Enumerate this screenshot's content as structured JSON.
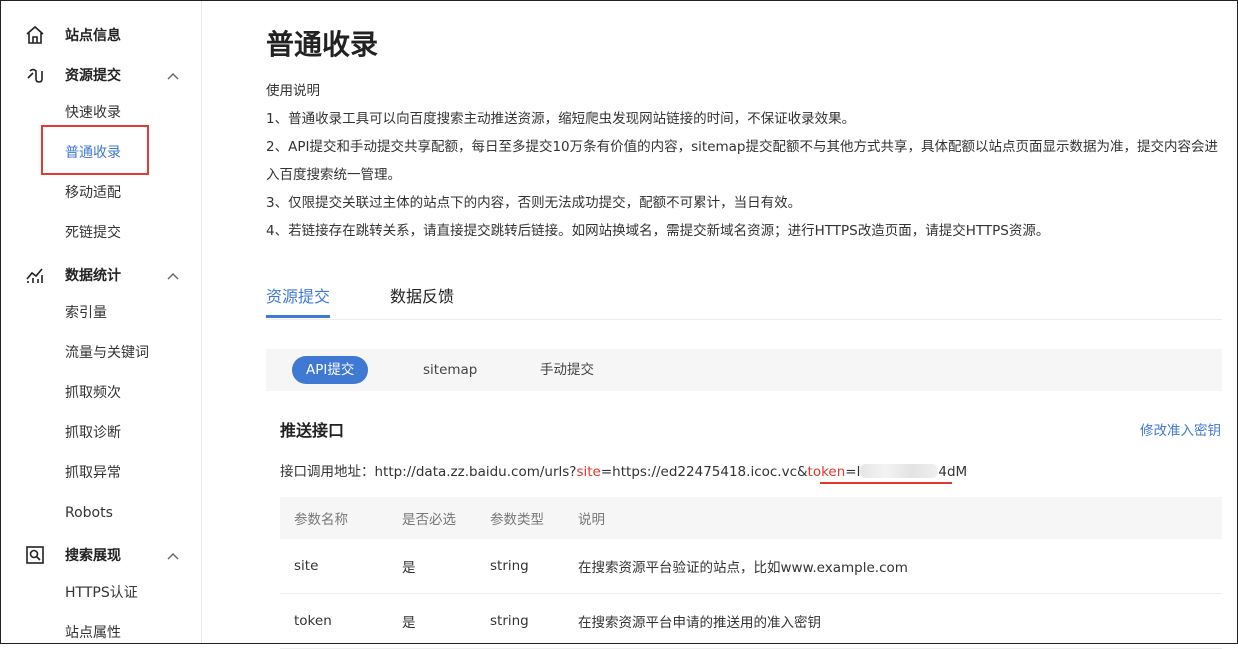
{
  "sidebar": {
    "sections": [
      {
        "label": "站点信息",
        "icon": "home-icon"
      },
      {
        "label": "资源提交",
        "icon": "resource-submit-icon"
      },
      {
        "label": "数据统计",
        "icon": "statistics-icon"
      },
      {
        "label": "搜索展现",
        "icon": "search-display-icon"
      }
    ],
    "items": {
      "submit": [
        "快速收录",
        "普通收录",
        "移动适配",
        "死链提交"
      ],
      "stats": [
        "索引量",
        "流量与关键词",
        "抓取频次",
        "抓取诊断",
        "抓取异常",
        "Robots"
      ],
      "display": [
        "HTTPS认证",
        "站点属性"
      ]
    }
  },
  "page": {
    "title": "普通收录",
    "instructions": {
      "heading": "使用说明",
      "lines": [
        "1、普通收录工具可以向百度搜索主动推送资源，缩短爬虫发现网站链接的时间，不保证收录效果。",
        "2、API提交和手动提交共享配额，每日至多提交10万条有价值的内容，sitemap提交配额不与其他方式共享，具体配额以站点页面显示数据为准，提交内容会进入百度搜索统一管理。",
        "3、仅限提交关联过主体的站点下的内容，否则无法成功提交，配额不可累计，当日有效。",
        "4、若链接存在跳转关系，请直接提交跳转后链接。如网站换域名，需提交新域名资源；进行HTTPS改造页面，请提交HTTPS资源。"
      ]
    },
    "tabs": [
      "资源提交",
      "数据反馈"
    ],
    "subtabs": [
      "API提交",
      "sitemap",
      "手动提交"
    ],
    "section_title": "推送接口",
    "modify_link": "修改准入密钥",
    "api": {
      "label": "接口调用地址：",
      "base": "http://data.zz.baidu.com/urls?",
      "site_key": "site",
      "eq1": "=https://ed22475418.icoc.vc&",
      "token_key": "token",
      "eq2": "=",
      "token_prefix": "l",
      "token_suffix": "4dM"
    },
    "table": {
      "headers": [
        "参数名称",
        "是否必选",
        "参数类型",
        "说明"
      ],
      "rows": [
        [
          "site",
          "是",
          "string",
          "在搜索资源平台验证的站点，比如www.example.com"
        ],
        [
          "token",
          "是",
          "string",
          "在搜索资源平台申请的推送用的准入密钥"
        ]
      ]
    }
  },
  "colors": {
    "accent": "#3f79d4",
    "highlight": "#e53935",
    "param": "#e0372f"
  }
}
